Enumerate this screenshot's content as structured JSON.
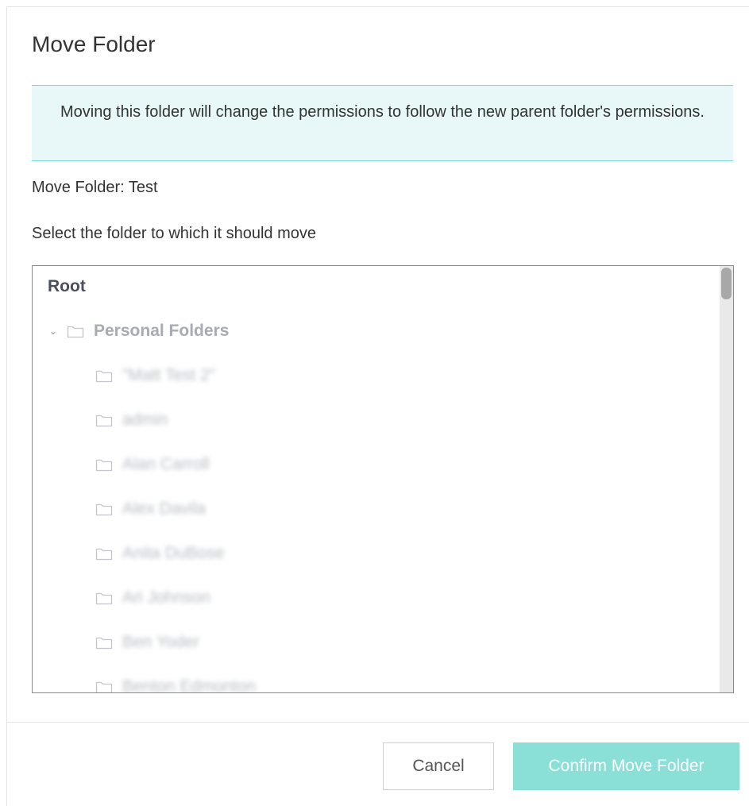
{
  "dialog": {
    "title": "Move Folder",
    "alert_text": "Moving this folder will change the permissions to follow the new parent folder's permissions.",
    "move_folder_text": "Move Folder: Test",
    "select_text": "Select the folder to which it should move"
  },
  "tree": {
    "root_label": "Root",
    "personal": {
      "label": "Personal Folders",
      "expanded": true,
      "caret_icon": "chevron-down-icon",
      "folder_icon": "folder-icon"
    },
    "children": [
      {
        "label": "\"Matt Test 2\""
      },
      {
        "label": "admin"
      },
      {
        "label": "Alan Carroll"
      },
      {
        "label": "Alex Davila"
      },
      {
        "label": "Anita DuBose"
      },
      {
        "label": "Ari Johnson"
      },
      {
        "label": "Ben Yoder"
      },
      {
        "label": "Benton Edmonton"
      }
    ]
  },
  "buttons": {
    "cancel_label": "Cancel",
    "confirm_label": "Confirm Move Folder"
  },
  "colors": {
    "alert_bg": "#e8f8f8",
    "alert_border": "#7fd6d6",
    "confirm_bg": "#8adfd7"
  }
}
